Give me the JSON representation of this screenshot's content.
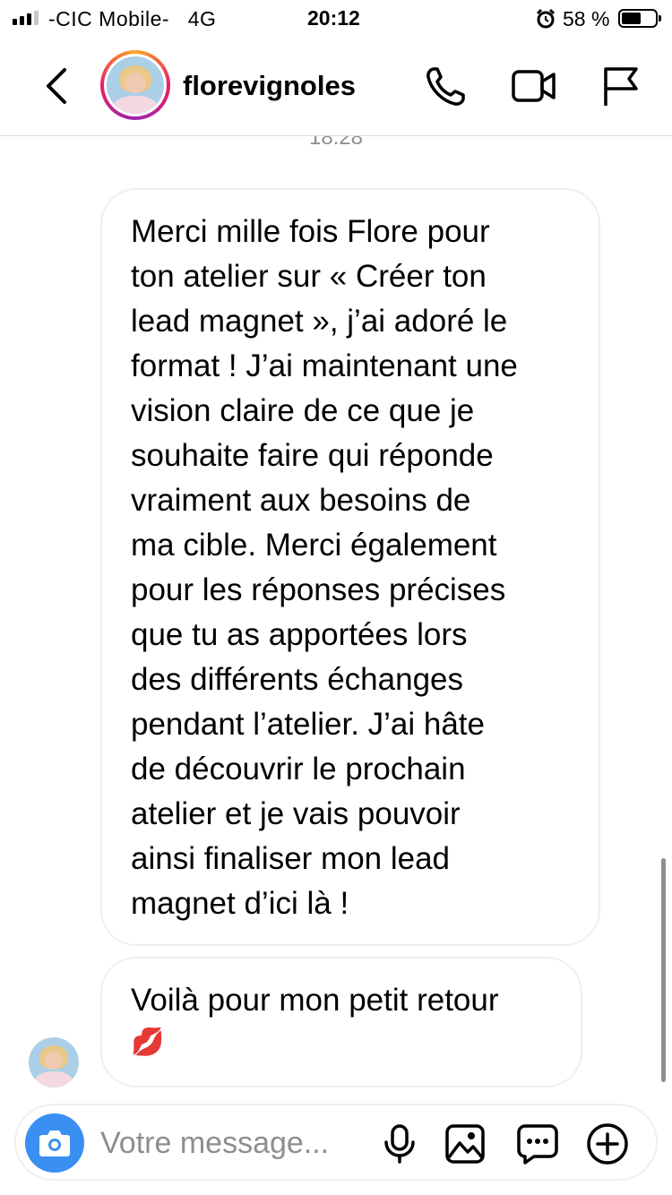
{
  "status_bar": {
    "carrier": "-CIC Mobile-   4G",
    "time": "20:12",
    "battery_percent": "58 %",
    "battery_level": 0.58
  },
  "header": {
    "username": "florevignoles"
  },
  "conversation": {
    "timestamp": "18:28",
    "messages": [
      {
        "lines": [
          "Merci mille fois Flore pour",
          "ton atelier sur « Créer ton",
          "lead magnet », j’ai adoré le",
          "format ! J’ai maintenant une",
          "vision claire de ce que je",
          "souhaite faire qui réponde",
          "vraiment aux besoins de",
          "ma cible. Merci également",
          "pour les réponses précises",
          "que tu as apportées lors",
          "des différents échanges",
          "pendant l’atelier. J’ai hâte",
          "de découvrir le prochain",
          "atelier et je vais pouvoir",
          "ainsi finaliser mon lead",
          "magnet d’ici là !"
        ]
      },
      {
        "lines": [
          "Voilà pour mon petit retour"
        ],
        "emoji": "💋"
      }
    ]
  },
  "composer": {
    "placeholder": "Votre message..."
  },
  "icons": {
    "back": "chevron-left-icon",
    "call": "phone-icon",
    "video": "video-camera-icon",
    "report": "flag-icon",
    "camera": "camera-icon",
    "mic": "microphone-icon",
    "gallery": "image-icon",
    "sticker": "chat-bubble-icon",
    "more": "plus-circle-icon"
  },
  "colors": {
    "camera_button": "#3a8ff2",
    "bubble_border": "#efefef",
    "secondary_text": "#8e8e8e"
  }
}
